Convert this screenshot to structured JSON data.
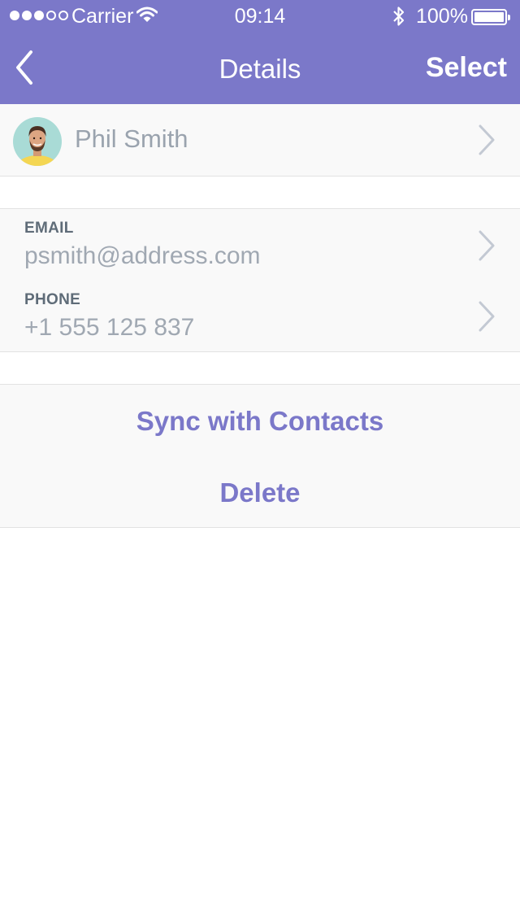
{
  "status_bar": {
    "carrier": "Carrier",
    "time": "09:14",
    "battery_percent": "100%",
    "signal_strength": "3 of 5",
    "battery_level": 1.0
  },
  "nav": {
    "title": "Details",
    "select_label": "Select",
    "back_icon": "chevron-left-icon"
  },
  "contact": {
    "name": "Phil Smith",
    "avatar_icon": "avatar"
  },
  "fields": {
    "email": {
      "label": "EMAIL",
      "value": "psmith@address.com"
    },
    "phone": {
      "label": "PHONE",
      "value": "+1 555 125 837"
    }
  },
  "actions": {
    "sync_label": "Sync with Contacts",
    "delete_label": "Delete"
  },
  "colors": {
    "accent": "#7b78c9",
    "row_bg": "#f9f9f9",
    "separator": "#e2e2e2",
    "label": "#5f6c78",
    "value": "#a0a8b2"
  }
}
